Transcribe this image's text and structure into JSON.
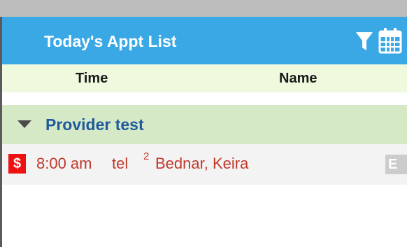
{
  "header": {
    "title": "Today's Appt List",
    "icons": [
      "filter-icon",
      "calendar-icon"
    ]
  },
  "columns": {
    "time_label": "Time",
    "name_label": "Name"
  },
  "provider": {
    "label": "Provider test",
    "expanded": true
  },
  "appointments": [
    {
      "badge": "$",
      "time": "8:00 am",
      "category": "tel",
      "count": "2",
      "name": "Bednar, Keira",
      "status_badge": "E"
    }
  ],
  "colors": {
    "header_bg": "#3ba8e6",
    "column_header_bg": "#eef9dd",
    "provider_bg": "#d6e9c6",
    "provider_text": "#1e5a9c",
    "appt_text": "#c0392b",
    "badge_red": "#ee1111"
  }
}
